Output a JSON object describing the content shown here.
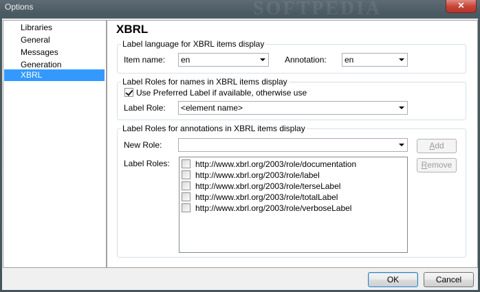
{
  "window": {
    "title": "Options",
    "close_glyph": "✕",
    "watermark": "SOFTPEDIA"
  },
  "nav": {
    "items": [
      {
        "label": "Libraries",
        "selected": false
      },
      {
        "label": "General",
        "selected": false
      },
      {
        "label": "Messages",
        "selected": false
      },
      {
        "label": "Generation",
        "selected": false
      },
      {
        "label": "XBRL",
        "selected": true
      }
    ]
  },
  "page": {
    "title": "XBRL"
  },
  "language_group": {
    "legend": "Label language for XBRL items display",
    "item_name_label": "Item name:",
    "item_name_value": "en",
    "annotation_label": "Annotation:",
    "annotation_value": "en"
  },
  "roles_group": {
    "legend": "Label Roles for names in XBRL items display",
    "use_preferred_label": "Use Preferred Label if available, otherwise use",
    "use_preferred_checked": true,
    "label_role_label": "Label Role:",
    "label_role_value": "<element name>"
  },
  "annotations_group": {
    "legend": "Label Roles for annotations in XBRL items display",
    "new_role_label": "New Role:",
    "new_role_value": "",
    "add_prefix": "",
    "add_underline": "A",
    "add_rest": "dd",
    "remove_prefix": "",
    "remove_underline": "R",
    "remove_rest": "emove",
    "label_roles_label": "Label Roles:",
    "roles": [
      {
        "url": "http://www.xbrl.org/2003/role/documentation",
        "checked": false
      },
      {
        "url": "http://www.xbrl.org/2003/role/label",
        "checked": false
      },
      {
        "url": "http://www.xbrl.org/2003/role/terseLabel",
        "checked": false
      },
      {
        "url": "http://www.xbrl.org/2003/role/totalLabel",
        "checked": false
      },
      {
        "url": "http://www.xbrl.org/2003/role/verboseLabel",
        "checked": false
      }
    ]
  },
  "footer": {
    "ok_label": "OK",
    "cancel_label": "Cancel"
  },
  "colors": {
    "selection": "#3399ff",
    "title_bar": "#4a5a62",
    "close_button": "#c7463a"
  },
  "icons": {
    "close": "close-icon",
    "dropdown": "chevron-down-icon",
    "checkbox_checked": "check-icon"
  }
}
